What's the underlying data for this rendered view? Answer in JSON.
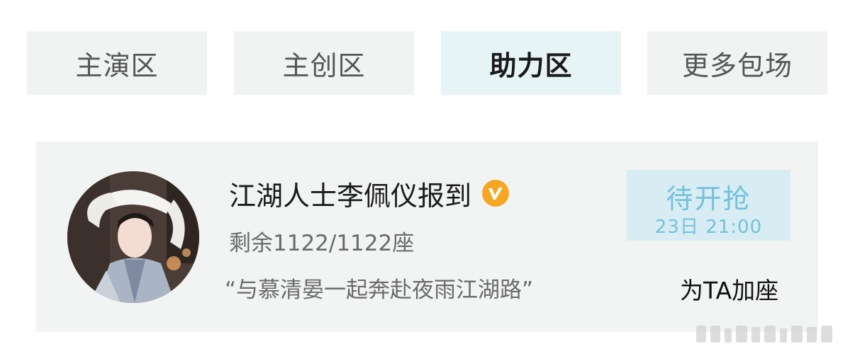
{
  "tabs": [
    {
      "label": "主演区",
      "active": false
    },
    {
      "label": "主创区",
      "active": false
    },
    {
      "label": "助力区",
      "active": true
    },
    {
      "label": "更多包场",
      "active": false
    }
  ],
  "card": {
    "name": "江湖人士李佩仪报到",
    "badge_icon": "v-verified-icon",
    "seats_text": "剩余1122/1122座",
    "seats_remaining": 1122,
    "seats_total": 1122,
    "slogan": "“与慕清晏一起奔赴夜雨江湖路”",
    "button": {
      "title": "待开抢",
      "time": "23日 21:00"
    },
    "add_seat_label": "为TA加座"
  },
  "colors": {
    "accent": "#74c1dc",
    "button_bg": "#d7edf3",
    "active_tab_bg": "#e6f4f6",
    "tab_bg": "#f1f3f3",
    "card_bg": "#f2f3f3",
    "badge": "#f5a623"
  }
}
